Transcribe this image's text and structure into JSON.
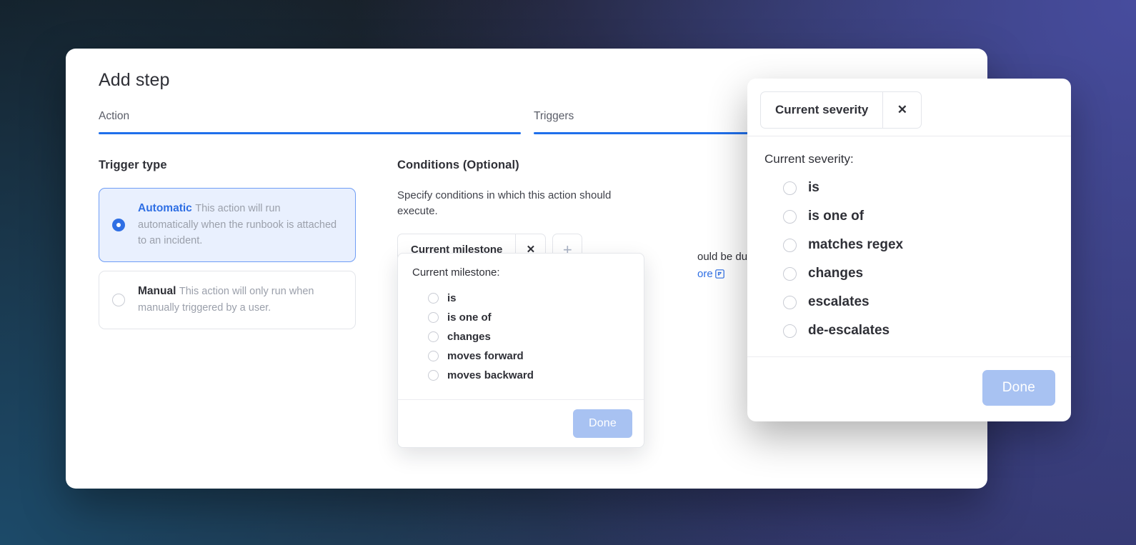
{
  "background": {
    "gradient_from": "#111214",
    "gradient_mid": "#1c4a69",
    "gradient_to": "#474c9e"
  },
  "colors": {
    "accent": "#2f6fe4",
    "tab_underline": "#1f6feb",
    "selected_card_bg": "#e9f0fe",
    "done_button_bg": "#a8c2f2",
    "muted_text": "#9ba0ab",
    "body_text": "#2f3037"
  },
  "dialog": {
    "title": "Add step",
    "tabs": [
      {
        "label": "Action",
        "active": true
      },
      {
        "label": "Triggers",
        "active": true
      }
    ]
  },
  "trigger_type": {
    "heading": "Trigger type",
    "options": [
      {
        "title": "Automatic",
        "description": "This action will run automatically when the runbook is attached to an incident.",
        "selected": true
      },
      {
        "title": "Manual",
        "description": "This action will only run when manually triggered by a user.",
        "selected": false
      }
    ]
  },
  "conditions": {
    "heading": "Conditions (Optional)",
    "description": "Specify conditions in which this action should execute.",
    "chips": [
      {
        "label": "Current milestone",
        "close_icon": "close-icon"
      }
    ],
    "add_button_icon": "plus-icon"
  },
  "milestone_popover": {
    "prompt": "Current milestone:",
    "options": [
      {
        "label": "is",
        "selected": false
      },
      {
        "label": "is one of",
        "selected": false
      },
      {
        "label": "changes",
        "selected": false
      },
      {
        "label": "moves forward",
        "selected": false
      },
      {
        "label": "moves backward",
        "selected": false
      }
    ],
    "done_label": "Done"
  },
  "note": {
    "text_fragment": "ould be duplicated. T",
    "link_fragment": "ore",
    "link_icon": "external-link-icon"
  },
  "severity_panel": {
    "chip": {
      "label": "Current severity",
      "close_icon": "close-icon"
    },
    "prompt": "Current severity:",
    "options": [
      {
        "label": "is",
        "selected": false
      },
      {
        "label": "is one of",
        "selected": false
      },
      {
        "label": "matches regex",
        "selected": false
      },
      {
        "label": "changes",
        "selected": false
      },
      {
        "label": "escalates",
        "selected": false
      },
      {
        "label": "de-escalates",
        "selected": false
      }
    ],
    "done_label": "Done"
  }
}
